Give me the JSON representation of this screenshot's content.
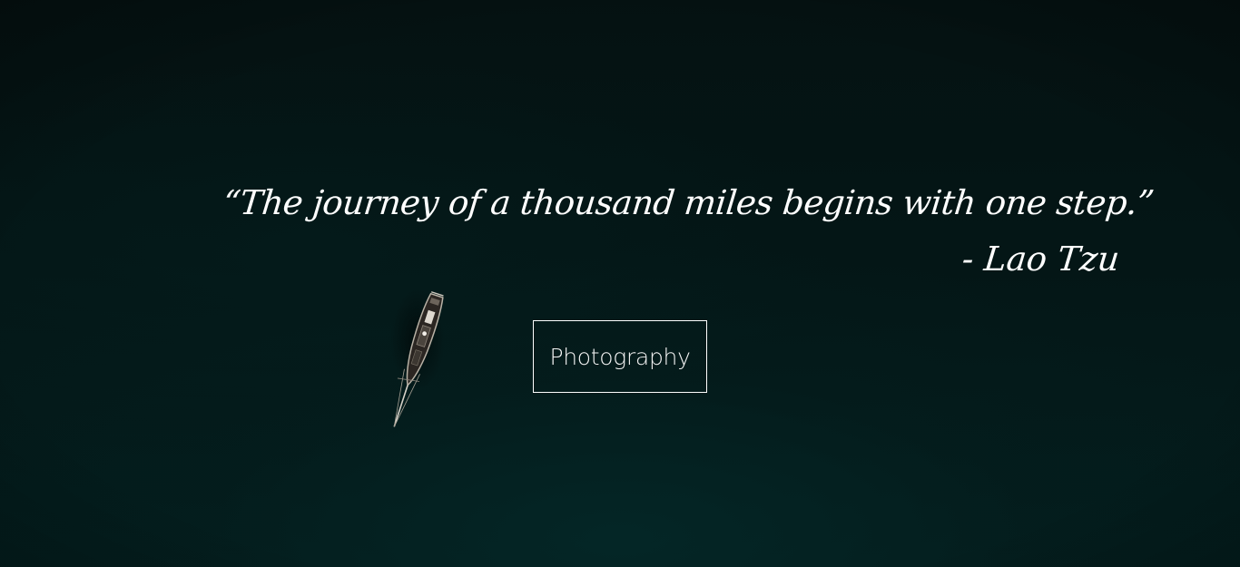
{
  "hero": {
    "quote_text": "“The journey of a thousand miles begins with one step.”",
    "author": "- Lao Tzu",
    "button_label": "Photography",
    "background_color": "#041616",
    "text_color": "#ffffff",
    "icon": "sailboat-icon"
  }
}
